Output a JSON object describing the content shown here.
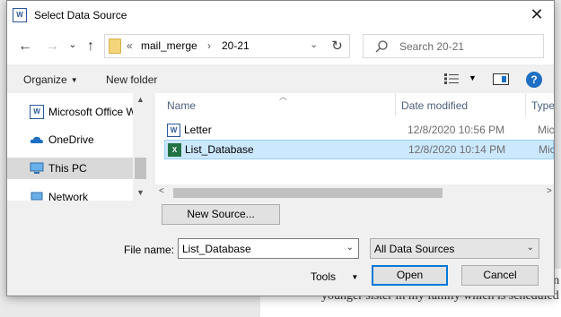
{
  "background": {
    "text_line": "younger sister in my family which is scheduled on",
    "text_fragment": "an"
  },
  "dialog": {
    "title": "Select Data Source",
    "title_icon": "word-icon",
    "close_glyph": "✕"
  },
  "nav": {
    "back_glyph": "←",
    "forward_glyph": "→",
    "recent_glyph": "⌄",
    "up_glyph": "↑",
    "address": {
      "chevron": "«",
      "segments": [
        "mail_merge",
        "20-21"
      ],
      "separator": "›",
      "dropdown_glyph": "⌄"
    },
    "refresh_glyph": "↻",
    "search_placeholder": "Search 20-21"
  },
  "toolbar": {
    "organize_label": "Organize",
    "caret": "▼",
    "new_folder_label": "New folder",
    "help_glyph": "?"
  },
  "sidebar": {
    "items": [
      {
        "label": "Microsoft Office W",
        "icon": "word-doc-icon"
      },
      {
        "label": "OneDrive",
        "icon": "onedrive-cloud-icon"
      },
      {
        "label": "This PC",
        "icon": "computer-icon",
        "selected": true
      },
      {
        "label": "Network",
        "icon": "network-icon"
      }
    ]
  },
  "files": {
    "columns": {
      "name": "Name",
      "date": "Date modified",
      "type": "Type"
    },
    "rows": [
      {
        "name": "Letter",
        "date": "12/8/2020 10:56 PM",
        "type": "Micro",
        "icon": "word-doc-icon",
        "icon_text": "W"
      },
      {
        "name": "List_Database",
        "date": "12/8/2020 10:14 PM",
        "type": "Micro",
        "icon": "excel-doc-icon",
        "icon_text": "X",
        "selected": true
      }
    ]
  },
  "bottom": {
    "new_source_label": "New Source...",
    "file_name_label": "File name:",
    "file_name_value": "List_Database",
    "filter_value": "All Data Sources",
    "tools_label": "Tools",
    "open_label": "Open",
    "cancel_label": "Cancel"
  },
  "colors": {
    "accent": "#0078d7",
    "selection_bg": "#cce8ff",
    "word": "#2b579a",
    "excel": "#217346"
  }
}
